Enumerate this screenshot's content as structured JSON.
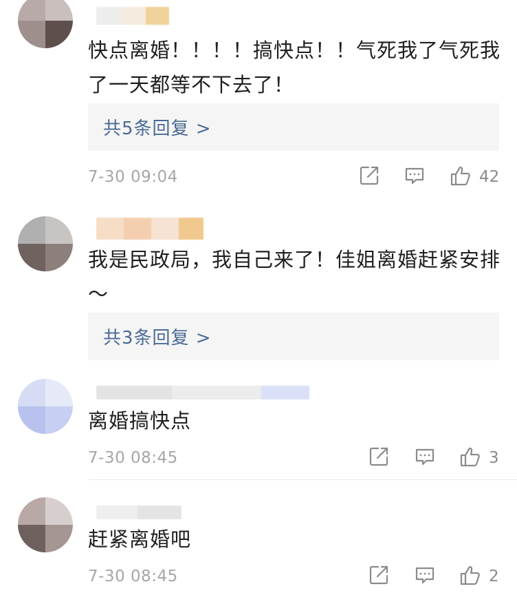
{
  "comments": [
    {
      "text": "快点离婚！！！！搞快点！！气死我了气死我了一天都等不下去了！",
      "reply_label": "共5条回复 >",
      "timestamp": "7-30 09:04",
      "likes": "42",
      "avatar_colors": [
        "#b7aaa8",
        "#c9bfbd",
        "#9e8f8c",
        "#5e4f4c"
      ],
      "name_colors": [
        "#ededed",
        "#f6ebdf",
        "#f0d39a"
      ]
    },
    {
      "text": "我是民政局，我自己来了！佳姐离婚赶紧安排～",
      "reply_label": "共3条回复 >",
      "timestamp": "",
      "likes": "",
      "avatar_colors": [
        "#b0b0b0",
        "#c8c4c2",
        "#6f625f",
        "#8c7f7c"
      ],
      "name_colors": [
        "#f6ddc6",
        "#f3cfb0",
        "#f6e3d4",
        "#f1c98e"
      ]
    },
    {
      "text": "离婚搞快点",
      "reply_label": "",
      "timestamp": "7-30 08:45",
      "likes": "3",
      "avatar_colors": [
        "#d6dcf3",
        "#e6e9f7",
        "#b7c2ee",
        "#c7d0f2"
      ],
      "name_colors": [
        "#e3e3e3",
        "#ececec",
        "#d9e0f7"
      ]
    },
    {
      "text": "赶紧离婚吧",
      "reply_label": "",
      "timestamp": "7-30 08:45",
      "likes": "2",
      "avatar_colors": [
        "#b9a9a6",
        "#d7cfcd",
        "#6e605d",
        "#a59693"
      ],
      "name_colors": [
        "#eeeeee",
        "#e4e4e4"
      ]
    }
  ],
  "icons": {
    "share": "share-icon",
    "comment": "comment-icon",
    "like": "thumbs-up-icon"
  },
  "colors": {
    "text": "#1f1f1f",
    "link": "#4a6a96",
    "meta": "#a6a6a6",
    "reply_bg": "#f5f5f5"
  }
}
